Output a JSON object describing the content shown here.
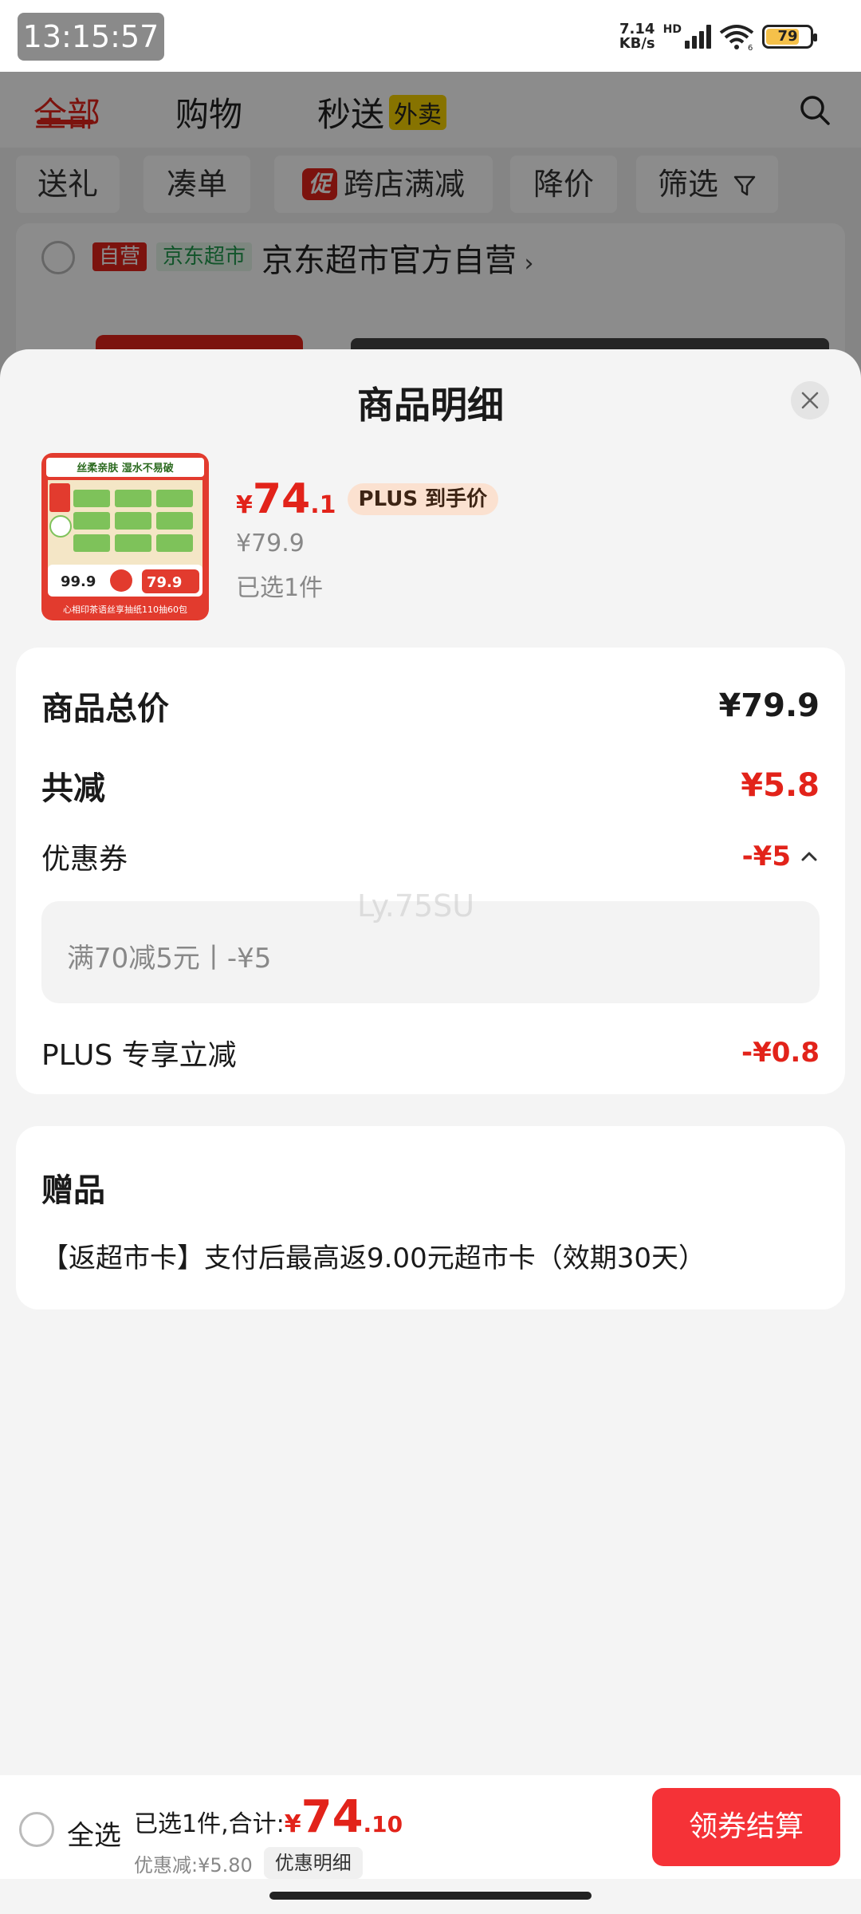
{
  "status_bar": {
    "time": "13:15:57",
    "net_speed_value": "7.14",
    "net_speed_unit": "KB/s",
    "hd_label": "HD",
    "wifi_label": "6",
    "battery_level": "79"
  },
  "background_page": {
    "tabs": [
      {
        "label": "全部"
      },
      {
        "label": "购物"
      },
      {
        "label": "秒送"
      }
    ],
    "waimai_tag": "外卖",
    "filters": [
      {
        "label": "送礼"
      },
      {
        "label": "凑单"
      },
      {
        "label": "跨店满减",
        "badge": "促"
      },
      {
        "label": "降价"
      },
      {
        "label": "筛选"
      }
    ],
    "store": {
      "tag_ziying": "自营",
      "tag_market": "京东超市",
      "name": "京东超市官方自营"
    }
  },
  "sheet": {
    "title": "商品明细",
    "product": {
      "thumb_slogan": "丝柔亲肤 湿水不易破",
      "thumb_price_left": "99.9",
      "thumb_price_right": "79.9",
      "thumb_caption": "心相印茶语丝享抽纸110抽60包",
      "price_yen": "¥",
      "price_int": "74",
      "price_dec": ".1",
      "plus_badge": "PLUS 到手价",
      "original_price": "¥79.9",
      "selected_qty": "已选1件"
    },
    "summary": {
      "total_label": "商品总价",
      "total_value": "¥79.9",
      "reduce_label": "共减",
      "reduce_value": "¥5.8",
      "coupon_label": "优惠券",
      "coupon_value": "-¥5",
      "coupon_detail": "满70减5元丨-¥5",
      "plus_label": "PLUS 专享立减",
      "plus_value": "-¥0.8",
      "watermark": "Ly.75SU"
    },
    "gift": {
      "title": "赠品",
      "desc": "【返超市卡】支付后最高返9.00元超市卡（效期30天）"
    }
  },
  "bottom_bar": {
    "select_all": "全选",
    "total_prefix": "已选1件,合计:",
    "total_yen": "¥",
    "total_int": "74",
    "total_dec": ".10",
    "discount_text": "优惠减:¥5.80",
    "discount_detail": "优惠明细",
    "checkout": "领券结算"
  },
  "colors": {
    "accent_red": "#e2231a",
    "checkout_red": "#f53237",
    "plus_badge_bg": "#fbe1d0"
  },
  "icons": [
    "close-icon",
    "search-icon",
    "filter-icon",
    "chevron-up-icon",
    "chevron-right-icon",
    "wifi-icon",
    "signal-icon",
    "battery-icon"
  ]
}
